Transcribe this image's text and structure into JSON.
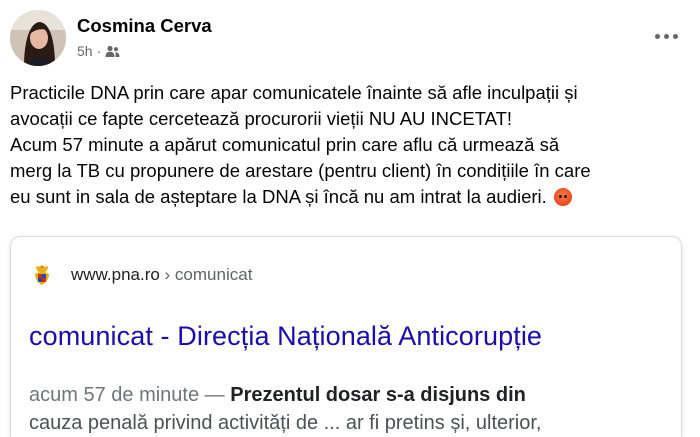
{
  "post": {
    "author": "Cosmina Cerva",
    "time": "5h",
    "separator": "·",
    "audience_icon": "friends-icon",
    "text_lines": [
      "Practicile DNA prin care apar comunicatele înainte să afle inculpații și",
      "avocații ce fapte cercetează procurorii vieții NU AU INCETAT!",
      "Acum 57 minute a apărut comunicatul prin care aflu că urmează să",
      "merg la TB cu propunere de arestare (pentru client) în condițiile în care",
      "eu sunt in sala de așteptare la DNA și încă nu am intrat la audieri."
    ],
    "emoji": "angry-face-emoji"
  },
  "search_result": {
    "site": "www.pna.ro",
    "crumb": " › comunicat",
    "title": "comunicat - Direcția Națională Anticorupție",
    "date": "acum 57 de minute",
    "dash": " — ",
    "snippet_bold": "Prezentul dosar s-a disjuns din",
    "snippet_line2": "cauza penală privind activități de ... ar fi pretins și, ulterior,"
  },
  "colors": {
    "link": "#1a0dab",
    "meta": "#65676b",
    "snippet": "#4d5156"
  }
}
